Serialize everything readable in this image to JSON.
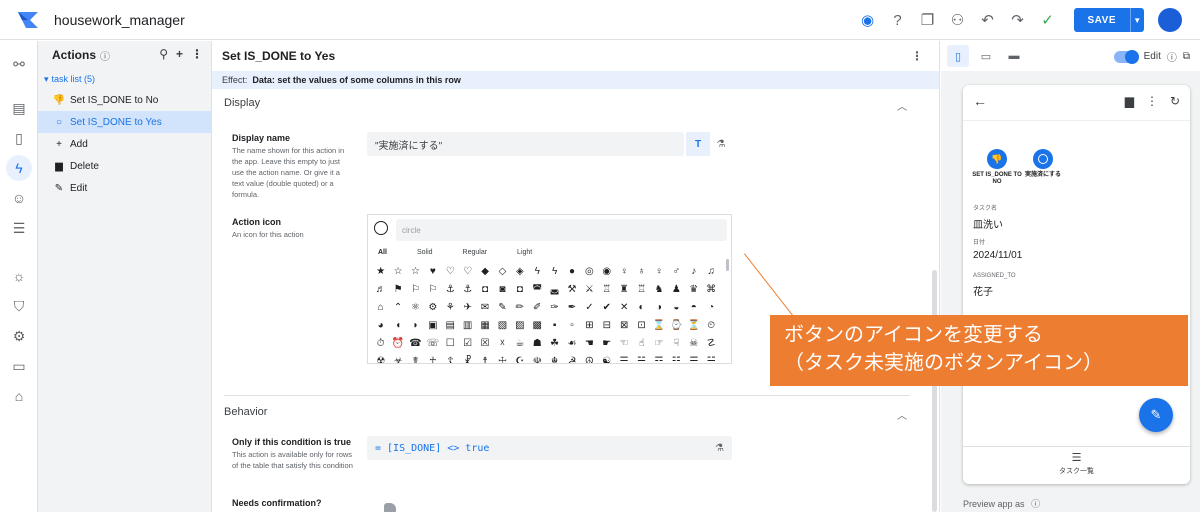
{
  "app": {
    "name": "housework_manager",
    "save_label": "SAVE"
  },
  "actions_panel": {
    "title": "Actions",
    "group": "task list (5)",
    "items": [
      {
        "label": "Set IS_DONE to No",
        "icon": "thumbs-down-icon",
        "selected": false
      },
      {
        "label": "Set IS_DONE to Yes",
        "icon": "circle-icon",
        "selected": true
      },
      {
        "label": "Add",
        "icon": "plus-icon",
        "selected": false
      },
      {
        "label": "Delete",
        "icon": "trash-icon",
        "selected": false
      },
      {
        "label": "Edit",
        "icon": "edit-icon",
        "selected": false
      }
    ]
  },
  "editor": {
    "title": "Set IS_DONE to Yes",
    "effect_label": "Effect:",
    "effect_value": "Data: set the values of some columns in this row",
    "display_section": "Display",
    "display_name_label": "Display name",
    "display_name_desc": "The name shown for this action in the app. Leave this empty to just use the action name. Or give it a text value (double quoted) or a formula.",
    "display_name_value": "\"実施済にする\"",
    "action_icon_label": "Action icon",
    "action_icon_desc": "An icon for this action",
    "icon_search_placeholder": "circle",
    "icon_tabs": [
      "All",
      "Solid",
      "Regular",
      "Light"
    ],
    "behavior_section": "Behavior",
    "condition_label": "Only if this condition is true",
    "condition_desc": "This action is available only for rows of the table that satisfy this condition",
    "condition_value": "= [IS_DONE] <> true",
    "confirm_label": "Needs confirmation?"
  },
  "preview": {
    "edit_label": "Edit",
    "actions": [
      {
        "label": "SET IS_DONE TO NO",
        "icon": "thumbs-down-icon"
      },
      {
        "label": "実施済にする",
        "icon": "circle-icon"
      }
    ],
    "fields": [
      {
        "key": "タスク名",
        "value": "皿洗い"
      },
      {
        "key": "日付",
        "value": "2024/11/01"
      },
      {
        "key": "ASSIGNED_TO",
        "value": "花子"
      }
    ],
    "bottom_nav": "タスク一覧",
    "footer": "Preview app as"
  },
  "callout": {
    "line1": "ボタンのアイコンを変更する",
    "line2": "（タスク未実施のボタンアイコン）"
  },
  "colors": {
    "accent": "#1a73e8",
    "callout": "#ed7d31"
  }
}
